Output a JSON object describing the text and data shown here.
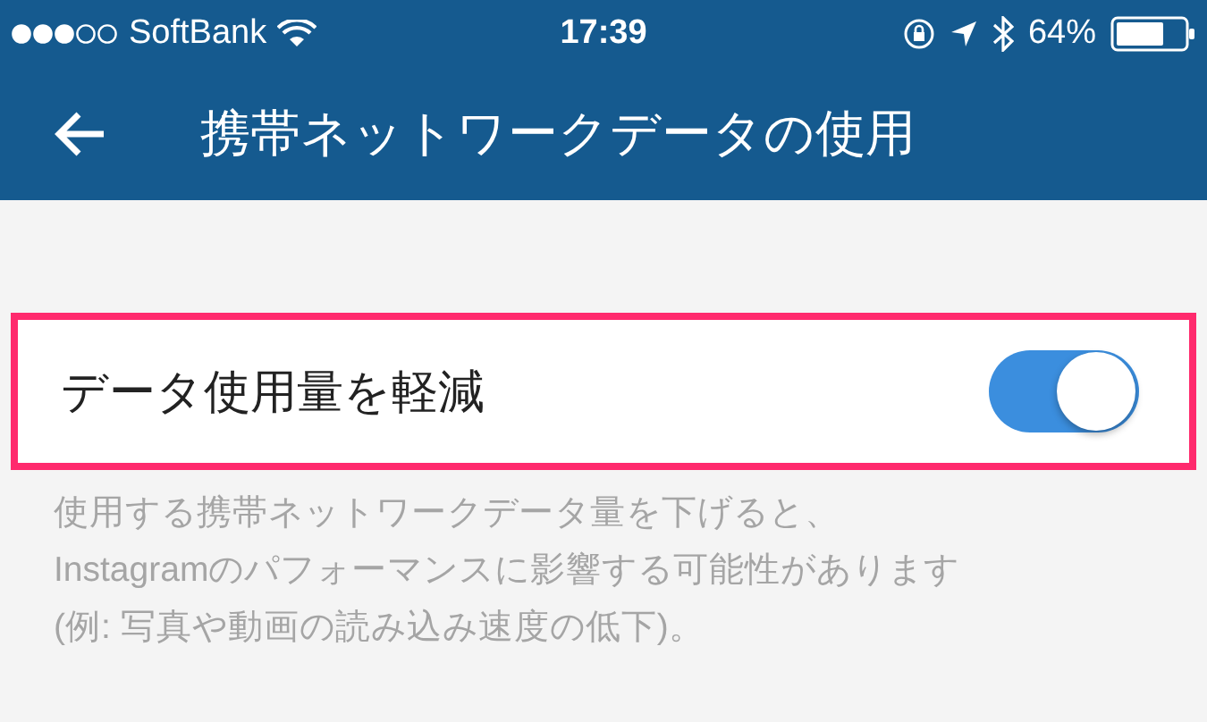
{
  "status_bar": {
    "carrier": "SoftBank",
    "time": "17:39",
    "battery": "64%"
  },
  "header": {
    "title": "携帯ネットワークデータの使用"
  },
  "settings": [
    {
      "kind": "toggle",
      "label": "データ使用量を軽減",
      "on": true,
      "highlighted": true
    }
  ],
  "description": "使用する携帯ネットワークデータ量を下げると、\nInstagramのパフォーマンスに影響する可能性があります\n(例: 写真や動画の読み込み速度の低下)。"
}
